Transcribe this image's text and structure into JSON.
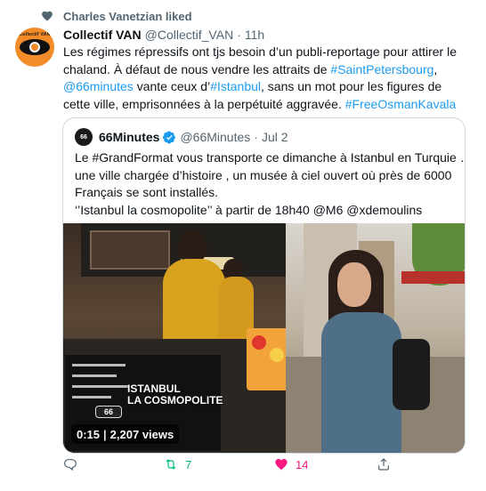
{
  "social_context": {
    "icon": "heart-icon",
    "text": "Charles Vanetzian liked"
  },
  "tweet": {
    "author_name": "Collectif VAN",
    "author_handle": "@Collectif_VAN",
    "separator": "·",
    "time": "11h",
    "avatar_label": "Collectif VAN",
    "avatar_text": "VAN",
    "text_parts": {
      "p1": "Les régimes répressifs ont tjs besoin d’un publi-reportage pour attirer le chaland. À défaut de nous vendre les attraits de ",
      "hashtag1": "#SaintPetersbourg",
      "p2": ",",
      "mention1": "@66minutes",
      "p3": " vante ceux d’",
      "hashtag2": "#Istanbul",
      "p4": ", sans un mot pour les figures de cette ville, emprisonnées à la perpétuité aggravée. ",
      "hashtag3": "#FreeOsmanKavala"
    }
  },
  "quoted_tweet": {
    "avatar_text": "66",
    "author_name": "66Minutes",
    "verified_icon": "verified-badge-icon",
    "author_handle": "@66Minutes",
    "separator": "·",
    "date": "Jul 2",
    "lines": [
      "Le #GrandFormat vous transporte ce dimanche à Istanbul en Turquie …",
      "une ville chargée d’histoire , un musée à ciel ouvert où près de 6000",
      "Français se sont installés.",
      "‘’Istanbul la cosmopolite’’ à partir de 18h40  @M6 @xdemoulins"
    ],
    "media": {
      "overlay_title_line1": "ISTANBUL",
      "overlay_title_line2": "LA COSMOPOLITE",
      "channel_logo": "66",
      "duration": "0:15",
      "badge_separator": "|",
      "views": "2,207 views"
    }
  },
  "actions": {
    "reply": {
      "icon": "reply-icon",
      "count": ""
    },
    "retweet": {
      "icon": "retweet-icon",
      "count": "7",
      "color": "#00ba7c"
    },
    "like": {
      "icon": "heart-filled-icon",
      "count": "14",
      "color": "#f91880"
    },
    "share": {
      "icon": "share-icon",
      "count": ""
    }
  },
  "colors": {
    "link": "#1d9bf0",
    "secondary_text": "#536471",
    "border": "#cfd9de",
    "avatar_orange": "#f28c28"
  }
}
